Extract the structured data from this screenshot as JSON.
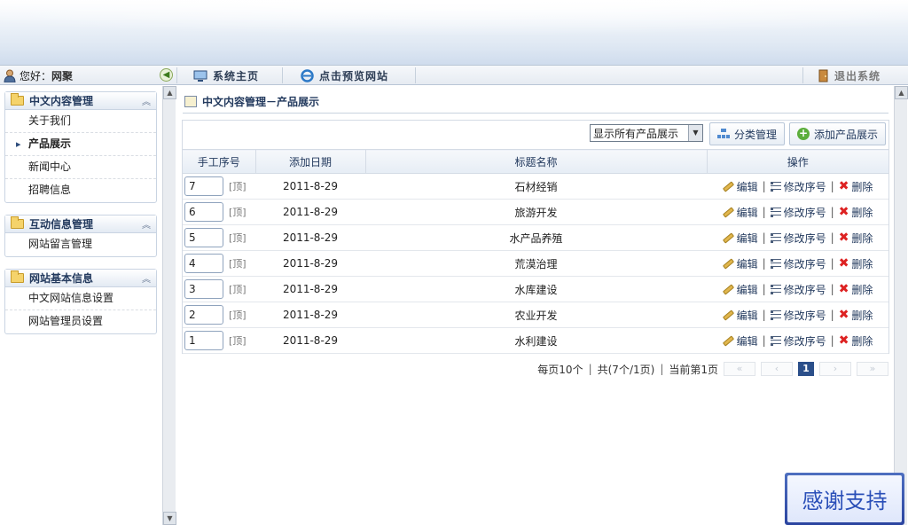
{
  "header": {
    "greeting": "您好：",
    "username": "网聚",
    "nav": [
      {
        "label": "系统主页",
        "icon": "monitor-icon"
      },
      {
        "label": "点击预览网站",
        "icon": "ie-browser-icon"
      }
    ],
    "logout_label": "退出系统"
  },
  "sidebar": {
    "sections": [
      {
        "title": "中文内容管理",
        "items": [
          {
            "label": "关于我们",
            "active": false
          },
          {
            "label": "产品展示",
            "active": true
          },
          {
            "label": "新闻中心",
            "active": false
          },
          {
            "label": "招聘信息",
            "active": false
          }
        ]
      },
      {
        "title": "互动信息管理",
        "items": [
          {
            "label": "网站留言管理",
            "active": false
          }
        ]
      },
      {
        "title": "网站基本信息",
        "items": [
          {
            "label": "中文网站信息设置",
            "active": false
          },
          {
            "label": "网站管理员设置",
            "active": false
          }
        ]
      }
    ]
  },
  "main": {
    "breadcrumb": "中文内容管理－产品展示",
    "filter_value": "显示所有产品展示",
    "category_button": "分类管理",
    "add_button": "添加产品展示",
    "columns": [
      "手工序号",
      "添加日期",
      "标题名称",
      "操作"
    ],
    "top_label": "[顶]",
    "actions": {
      "edit": "编辑",
      "reorder": "修改序号",
      "delete": "删除"
    },
    "rows": [
      {
        "order": "7",
        "date": "2011-8-29",
        "title": "石材经销"
      },
      {
        "order": "6",
        "date": "2011-8-29",
        "title": "旅游开发"
      },
      {
        "order": "5",
        "date": "2011-8-29",
        "title": "水产品养殖"
      },
      {
        "order": "4",
        "date": "2011-8-29",
        "title": "荒漠治理"
      },
      {
        "order": "3",
        "date": "2011-8-29",
        "title": "水库建设"
      },
      {
        "order": "2",
        "date": "2011-8-29",
        "title": "农业开发"
      },
      {
        "order": "1",
        "date": "2011-8-29",
        "title": "水利建设"
      }
    ],
    "pager": {
      "per_page": "每页10个",
      "total": "共(7个/1页)",
      "current": "当前第1页",
      "current_page": "1"
    }
  },
  "badge": {
    "text": "感谢支持"
  },
  "colors": {
    "accent": "#2b4f8a",
    "delete": "#dd2222",
    "folder": "#f5d36b"
  }
}
